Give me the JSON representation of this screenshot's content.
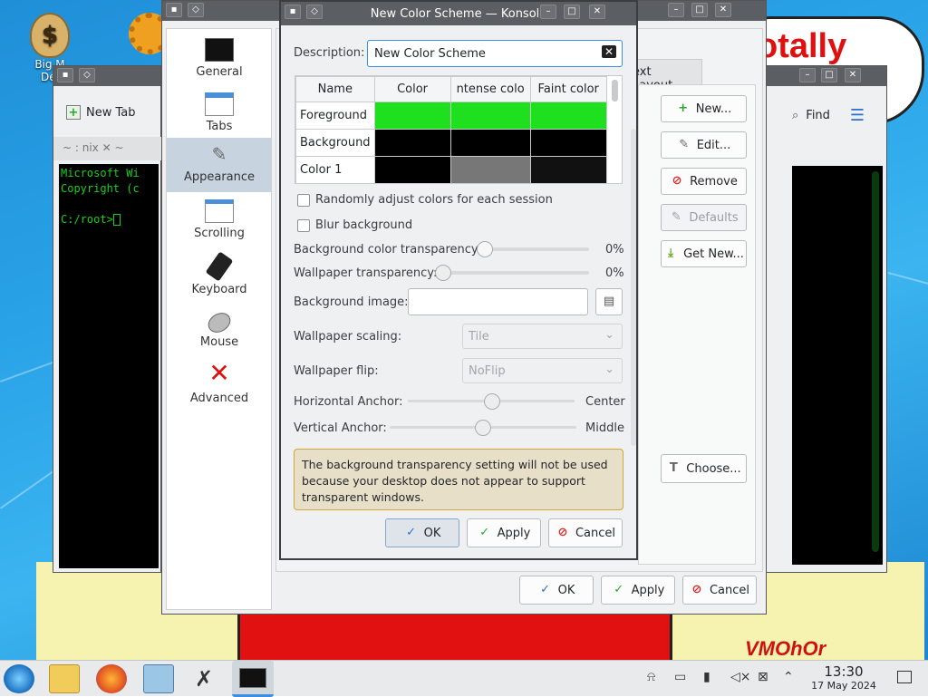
{
  "desktop": {
    "icons": [
      {
        "label": "Big M"
      },
      {
        "label": "Del"
      }
    ],
    "wallpaper_text": "otally",
    "wallpaper_tag": "VMOhOr"
  },
  "bg_konsole": {
    "tab_new": "New Tab",
    "tab_title": "~ : nix",
    "tab_title2": "~",
    "find": "Find",
    "term_lines": [
      "Microsoft Wi",
      "Copyright (c",
      "",
      "C:/root>"
    ]
  },
  "profile_dialog": {
    "tab_text_layout": "ext Layout",
    "side_buttons": [
      "New...",
      "Edit...",
      "Remove",
      "Defaults",
      "Get New..."
    ],
    "choose": "Choose...",
    "ok": "OK",
    "apply": "Apply",
    "cancel": "Cancel",
    "sidebar": [
      "General",
      "Tabs",
      "Appearance",
      "Scrolling",
      "Keyboard",
      "Mouse",
      "Advanced"
    ]
  },
  "scheme_dialog": {
    "title": "New Color Scheme — Konsole",
    "description_label": "Description:",
    "description_value": "New Color Scheme",
    "table": {
      "headers": [
        "Name",
        "Color",
        "ntense colo",
        "Faint color"
      ],
      "rows": [
        {
          "name": "Foreground",
          "colors": [
            "#1ee01e",
            "#1ee01e",
            "#1ee01e"
          ]
        },
        {
          "name": "Background",
          "colors": [
            "#000000",
            "#000000",
            "#000000"
          ]
        },
        {
          "name": "Color 1",
          "colors": [
            "#000000",
            "#777777",
            "#111111"
          ]
        }
      ]
    },
    "cb_random": "Randomly adjust colors for each session",
    "cb_blur": "Blur background",
    "bg_transparency_label": "Background color transparency:",
    "bg_transparency_value": "0%",
    "wp_transparency_label": "Wallpaper transparency:",
    "wp_transparency_value": "0%",
    "bg_image_label": "Background image:",
    "wp_scaling_label": "Wallpaper scaling:",
    "wp_scaling_value": "Tile",
    "wp_flip_label": "Wallpaper flip:",
    "wp_flip_value": "NoFlip",
    "h_anchor_label": "Horizontal Anchor:",
    "h_anchor_value": "Center",
    "v_anchor_label": "Vertical Anchor:",
    "v_anchor_value": "Middle",
    "warning": "The background transparency setting will not be used because your desktop does not appear to support transparent windows.",
    "ok": "OK",
    "apply": "Apply",
    "cancel": "Cancel"
  },
  "taskbar": {
    "time": "13:30",
    "date": "17 May 2024"
  }
}
